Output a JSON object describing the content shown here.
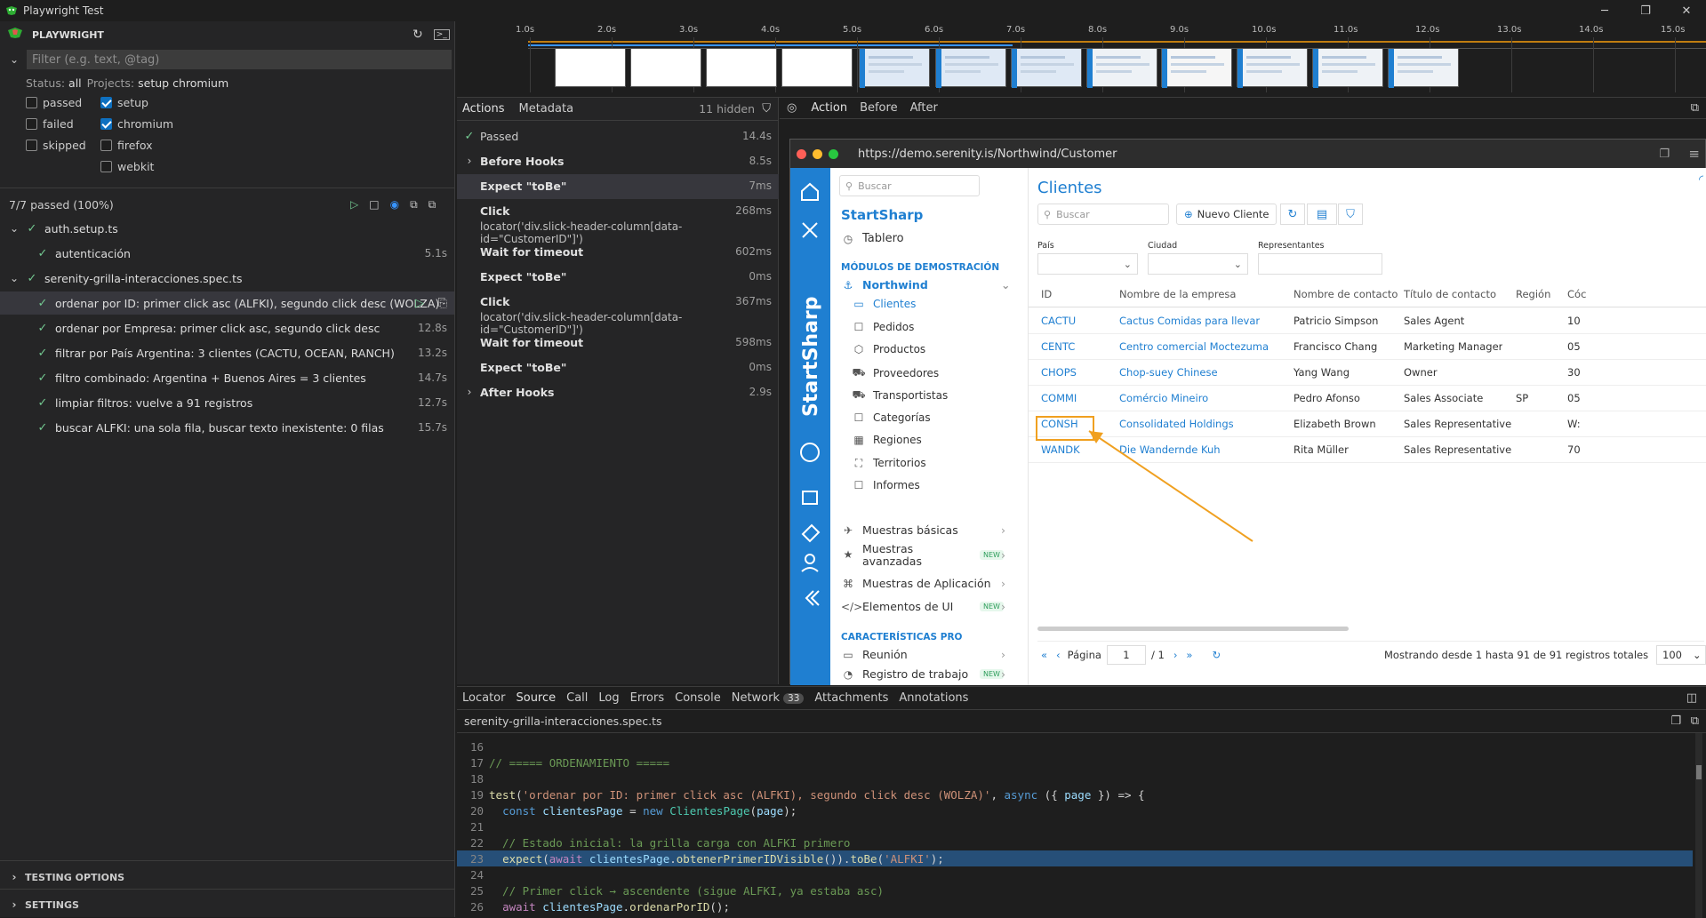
{
  "window": {
    "title": "Playwright Test"
  },
  "sidebar": {
    "header": "PLAYWRIGHT",
    "filter_placeholder": "Filter (e.g. text, @tag)",
    "status_label": "Status:",
    "status_value": "all",
    "projects_label": "Projects:",
    "projects_value": "setup chromium",
    "status_options": [
      {
        "label": "passed",
        "checked": false
      },
      {
        "label": "failed",
        "checked": false
      },
      {
        "label": "skipped",
        "checked": false
      }
    ],
    "project_options": [
      {
        "label": "setup",
        "checked": true
      },
      {
        "label": "chromium",
        "checked": true
      },
      {
        "label": "firefox",
        "checked": false
      },
      {
        "label": "webkit",
        "checked": false
      }
    ],
    "summary": "7/7 passed (100%)",
    "tree": [
      {
        "label": "auth.setup.ts",
        "level": 0,
        "duration": ""
      },
      {
        "label": "autenticación",
        "level": 1,
        "duration": "5.1s"
      },
      {
        "label": "serenity-grilla-interacciones.spec.ts",
        "level": 0,
        "duration": ""
      },
      {
        "label": "ordenar por ID: primer click asc (ALFKI), segundo click desc (WOLZA)",
        "level": 1,
        "duration": "",
        "selected": true
      },
      {
        "label": "ordenar por Empresa: primer click asc, segundo click desc",
        "level": 1,
        "duration": "12.8s"
      },
      {
        "label": "filtrar por País Argentina: 3 clientes (CACTU, OCEAN, RANCH)",
        "level": 1,
        "duration": "13.2s"
      },
      {
        "label": "filtro combinado: Argentina + Buenos Aires = 3 clientes",
        "level": 1,
        "duration": "14.7s"
      },
      {
        "label": "limpiar filtros: vuelve a 91 registros",
        "level": 1,
        "duration": "12.7s"
      },
      {
        "label": "buscar ALFKI: una sola fila, buscar texto inexistente: 0 filas",
        "level": 1,
        "duration": "15.7s"
      }
    ],
    "footer": [
      "TESTING OPTIONS",
      "SETTINGS"
    ]
  },
  "timeline": {
    "ticks": [
      "1.0s",
      "2.0s",
      "3.0s",
      "4.0s",
      "5.0s",
      "6.0s",
      "7.0s",
      "8.0s",
      "9.0s",
      "10.0s",
      "11.0s",
      "12.0s",
      "13.0s",
      "14.0s",
      "15.0s"
    ]
  },
  "actions_panel": {
    "tabs": [
      "Actions",
      "Metadata"
    ],
    "hidden": "11 hidden",
    "items": [
      {
        "name": "Passed",
        "sub": "",
        "duration": "14.4s",
        "kind": "passed"
      },
      {
        "name": "Before Hooks",
        "sub": "",
        "duration": "8.5s",
        "kind": "group"
      },
      {
        "name": "Expect \"toBe\"",
        "sub": "",
        "duration": "7ms",
        "kind": "selected"
      },
      {
        "name": "Click",
        "sub": "locator('div.slick-header-column[data-id=\"CustomerID\"]')",
        "duration": "268ms",
        "kind": "action"
      },
      {
        "name": "Wait for timeout",
        "sub": "",
        "duration": "602ms",
        "kind": "action"
      },
      {
        "name": "Expect \"toBe\"",
        "sub": "",
        "duration": "0ms",
        "kind": "action"
      },
      {
        "name": "Click",
        "sub": "locator('div.slick-header-column[data-id=\"CustomerID\"]')",
        "duration": "367ms",
        "kind": "action"
      },
      {
        "name": "Wait for timeout",
        "sub": "",
        "duration": "598ms",
        "kind": "action"
      },
      {
        "name": "Expect \"toBe\"",
        "sub": "",
        "duration": "0ms",
        "kind": "action"
      },
      {
        "name": "After Hooks",
        "sub": "",
        "duration": "2.9s",
        "kind": "group"
      }
    ]
  },
  "snapshot": {
    "tabs": [
      "Action",
      "Before",
      "After"
    ],
    "url": "https://demo.serenity.is/Northwind/Customer",
    "app": {
      "brand": "StartSharp",
      "nav_search_placeholder": "Buscar",
      "nav": {
        "tablero": "Tablero",
        "demo_section": "MÓDULOS DE DEMOSTRACIÓN",
        "northwind": "Northwind",
        "sub_items": [
          "Clientes",
          "Pedidos",
          "Productos",
          "Proveedores",
          "Transportistas",
          "Categorías",
          "Regiones",
          "Territorios",
          "Informes"
        ],
        "muestras_basicas": "Muestras básicas",
        "muestras_avanzadas_1": "Muestras",
        "muestras_avanzadas_2": "avanzadas",
        "muestras_app": "Muestras de Aplicación",
        "elementos_ui": "Elementos de UI",
        "new_badge": "NEW",
        "pro_section": "CARACTERÍSTICAS PRO",
        "reunion": "Reunión",
        "registro": "Registro de trabajo"
      },
      "page_title": "Clientes",
      "search_placeholder": "Buscar",
      "new_button": "Nuevo Cliente",
      "filters": {
        "pais": "País",
        "ciudad": "Ciudad",
        "representantes": "Representantes"
      },
      "columns": [
        "ID",
        "Nombre de la empresa",
        "Nombre de contacto",
        "Título de contacto",
        "Región",
        "Cóc"
      ],
      "rows": [
        {
          "id": "CACTU",
          "empresa": "Cactus Comidas para llevar",
          "contacto": "Patricio Simpson",
          "titulo": "Sales Agent",
          "region": "",
          "cod": "10"
        },
        {
          "id": "CENTC",
          "empresa": "Centro comercial Moctezuma",
          "contacto": "Francisco Chang",
          "titulo": "Marketing Manager",
          "region": "",
          "cod": "05"
        },
        {
          "id": "CHOPS",
          "empresa": "Chop-suey Chinese",
          "contacto": "Yang Wang",
          "titulo": "Owner",
          "region": "",
          "cod": "30"
        },
        {
          "id": "COMMI",
          "empresa": "Comércio Mineiro",
          "contacto": "Pedro Afonso",
          "titulo": "Sales Associate",
          "region": "SP",
          "cod": "05"
        },
        {
          "id": "CONSH",
          "empresa": "Consolidated Holdings",
          "contacto": "Elizabeth Brown",
          "titulo": "Sales Representative",
          "region": "",
          "cod": "W:"
        },
        {
          "id": "WANDK",
          "empresa": "Die Wandernde Kuh",
          "contacto": "Rita Müller",
          "titulo": "Sales Representative",
          "region": "",
          "cod": "70"
        }
      ],
      "pager": {
        "label": "Página",
        "page": "1",
        "of": "/ 1",
        "summary": "Mostrando desde 1 hasta 91 de 91 registros totales",
        "page_size": "100"
      }
    }
  },
  "bottom": {
    "tabs": [
      "Locator",
      "Source",
      "Call",
      "Log",
      "Errors",
      "Console",
      "Network",
      "Attachments",
      "Annotations"
    ],
    "network_count": "33",
    "file": "serenity-grilla-interacciones.spec.ts",
    "code_lines": [
      {
        "n": "16",
        "text": ""
      },
      {
        "n": "17",
        "text": "// ===== ORDENAMIENTO ====="
      },
      {
        "n": "18",
        "text": ""
      },
      {
        "n": "19",
        "text": "test('ordenar por ID: primer click asc (ALFKI), segundo click desc (WOLZA)', async ({ page }) => {"
      },
      {
        "n": "20",
        "text": "  const clientesPage = new ClientesPage(page);"
      },
      {
        "n": "21",
        "text": ""
      },
      {
        "n": "22",
        "text": "  // Estado inicial: la grilla carga con ALFKI primero"
      },
      {
        "n": "23",
        "text": "  expect(await clientesPage.obtenerPrimerIDVisible()).toBe('ALFKI');"
      },
      {
        "n": "24",
        "text": ""
      },
      {
        "n": "25",
        "text": "  // Primer click → ascendente (sigue ALFKI, ya estaba asc)"
      },
      {
        "n": "26",
        "text": "  await clientesPage.ordenarPorID();"
      }
    ]
  }
}
